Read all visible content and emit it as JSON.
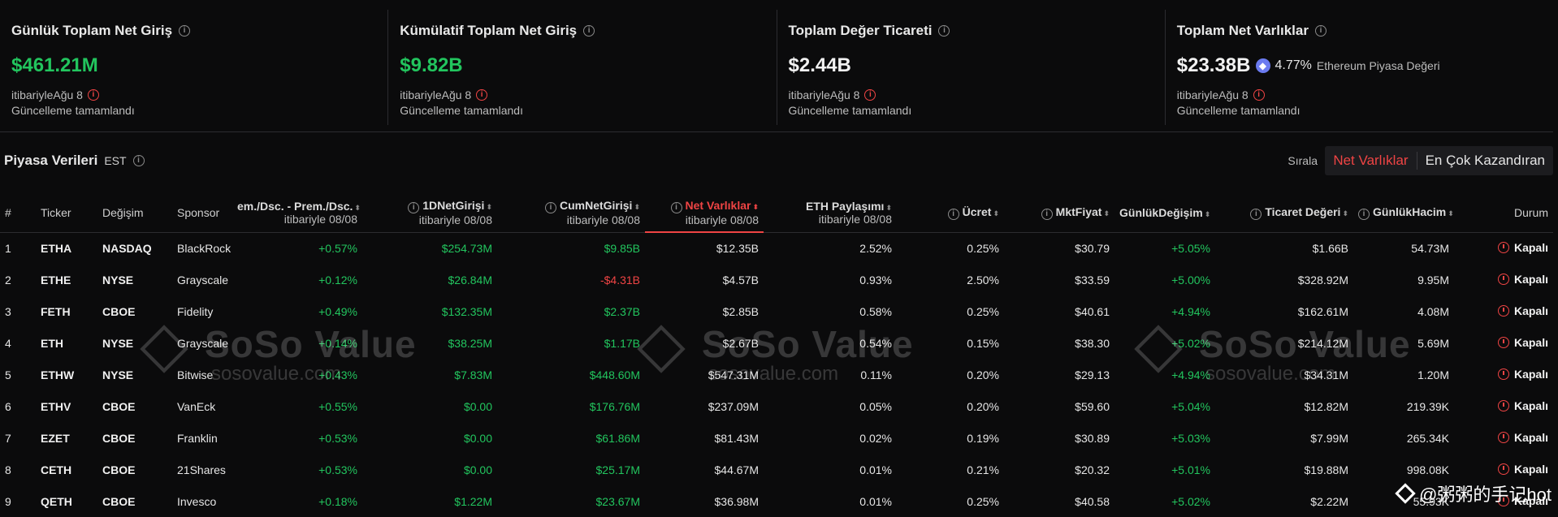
{
  "cards": [
    {
      "title": "Günlük Toplam Net Giriş",
      "value": "$461.21M",
      "note": "itibariyleAğu 8",
      "status": "Güncelleme tamamlandı"
    },
    {
      "title": "Kümülatif Toplam Net Giriş",
      "value": "$9.82B",
      "note": "itibariyleAğu 8",
      "status": "Güncelleme tamamlandı"
    },
    {
      "title": "Toplam Değer Ticareti",
      "value": "$2.44B",
      "note": "itibariyleAğu 8",
      "status": "Güncelleme tamamlandı"
    },
    {
      "title": "Toplam Net Varlıklar",
      "value": "$23.38B",
      "pct": "4.77%",
      "mcap_label": "Ethereum Piyasa Değeri",
      "note": "itibariyleAğu 8",
      "status": "Güncelleme tamamlandı"
    }
  ],
  "section": {
    "title": "Piyasa Verileri",
    "tz": "EST",
    "sort_label": "Sırala",
    "sort_active": "Net Varlıklar",
    "sort_other": "En Çok Kazandıran"
  },
  "headers": {
    "num": "#",
    "ticker": "Ticker",
    "exchange": "Değişim",
    "sponsor": "Sponsor",
    "prem": "em./Dsc. - Prem./Dsc.",
    "prem_sub": "itibariyle 08/08",
    "daily": "1DNetGirişi",
    "daily_sub": "itibariyle 08/08",
    "cum": "CumNetGirişi",
    "cum_sub": "itibariyle 08/08",
    "assets": "Net Varlıklar",
    "assets_sub": "itibariyle 08/08",
    "share": "ETH Paylaşımı",
    "share_sub": "itibariyle 08/08",
    "fee": "Ücret",
    "price": "MktFiyat",
    "change": "GünlükDeğişim",
    "value": "Ticaret Değeri",
    "volume": "GünlükHacim",
    "status": "Durum"
  },
  "rows": [
    {
      "num": "1",
      "ticker": "ETHA",
      "exchange": "NASDAQ",
      "sponsor": "BlackRock",
      "prem": "+0.57%",
      "daily": "$254.73M",
      "cum": "$9.85B",
      "assets": "$12.35B",
      "share": "2.52%",
      "fee": "0.25%",
      "price": "$30.79",
      "change": "+5.05%",
      "value": "$1.66B",
      "volume": "54.73M",
      "status": "Kapalı"
    },
    {
      "num": "2",
      "ticker": "ETHE",
      "exchange": "NYSE",
      "sponsor": "Grayscale",
      "prem": "+0.12%",
      "daily": "$26.84M",
      "cum": "-$4.31B",
      "assets": "$4.57B",
      "share": "0.93%",
      "fee": "2.50%",
      "price": "$33.59",
      "change": "+5.00%",
      "value": "$328.92M",
      "volume": "9.95M",
      "status": "Kapalı"
    },
    {
      "num": "3",
      "ticker": "FETH",
      "exchange": "CBOE",
      "sponsor": "Fidelity",
      "prem": "+0.49%",
      "daily": "$132.35M",
      "cum": "$2.37B",
      "assets": "$2.85B",
      "share": "0.58%",
      "fee": "0.25%",
      "price": "$40.61",
      "change": "+4.94%",
      "value": "$162.61M",
      "volume": "4.08M",
      "status": "Kapalı"
    },
    {
      "num": "4",
      "ticker": "ETH",
      "exchange": "NYSE",
      "sponsor": "Grayscale",
      "prem": "+0.14%",
      "daily": "$38.25M",
      "cum": "$1.17B",
      "assets": "$2.67B",
      "share": "0.54%",
      "fee": "0.15%",
      "price": "$38.30",
      "change": "+5.02%",
      "value": "$214.12M",
      "volume": "5.69M",
      "status": "Kapalı"
    },
    {
      "num": "5",
      "ticker": "ETHW",
      "exchange": "NYSE",
      "sponsor": "Bitwise",
      "prem": "+0.43%",
      "daily": "$7.83M",
      "cum": "$448.60M",
      "assets": "$547.31M",
      "share": "0.11%",
      "fee": "0.20%",
      "price": "$29.13",
      "change": "+4.94%",
      "value": "$34.31M",
      "volume": "1.20M",
      "status": "Kapalı"
    },
    {
      "num": "6",
      "ticker": "ETHV",
      "exchange": "CBOE",
      "sponsor": "VanEck",
      "prem": "+0.55%",
      "daily": "$0.00",
      "cum": "$176.76M",
      "assets": "$237.09M",
      "share": "0.05%",
      "fee": "0.20%",
      "price": "$59.60",
      "change": "+5.04%",
      "value": "$12.82M",
      "volume": "219.39K",
      "status": "Kapalı"
    },
    {
      "num": "7",
      "ticker": "EZET",
      "exchange": "CBOE",
      "sponsor": "Franklin",
      "prem": "+0.53%",
      "daily": "$0.00",
      "cum": "$61.86M",
      "assets": "$81.43M",
      "share": "0.02%",
      "fee": "0.19%",
      "price": "$30.89",
      "change": "+5.03%",
      "value": "$7.99M",
      "volume": "265.34K",
      "status": "Kapalı"
    },
    {
      "num": "8",
      "ticker": "CETH",
      "exchange": "CBOE",
      "sponsor": "21Shares",
      "prem": "+0.53%",
      "daily": "$0.00",
      "cum": "$25.17M",
      "assets": "$44.67M",
      "share": "0.01%",
      "fee": "0.21%",
      "price": "$20.32",
      "change": "+5.01%",
      "value": "$19.88M",
      "volume": "998.08K",
      "status": "Kapalı"
    },
    {
      "num": "9",
      "ticker": "QETH",
      "exchange": "CBOE",
      "sponsor": "Invesco",
      "prem": "+0.18%",
      "daily": "$1.22M",
      "cum": "$23.67M",
      "assets": "$36.98M",
      "share": "0.01%",
      "fee": "0.25%",
      "price": "$40.58",
      "change": "+5.02%",
      "value": "$2.22M",
      "volume": "55.93K",
      "status": "Kapalı"
    }
  ],
  "watermark": {
    "brand": "SoSo Value",
    "domain": "sosovalue.com"
  },
  "signature": "@粥粥的手记hot",
  "colors": {
    "positive": "#22c55e",
    "negative": "#ef4444",
    "accent": "#ef4444",
    "background": "#0b0b0c"
  }
}
